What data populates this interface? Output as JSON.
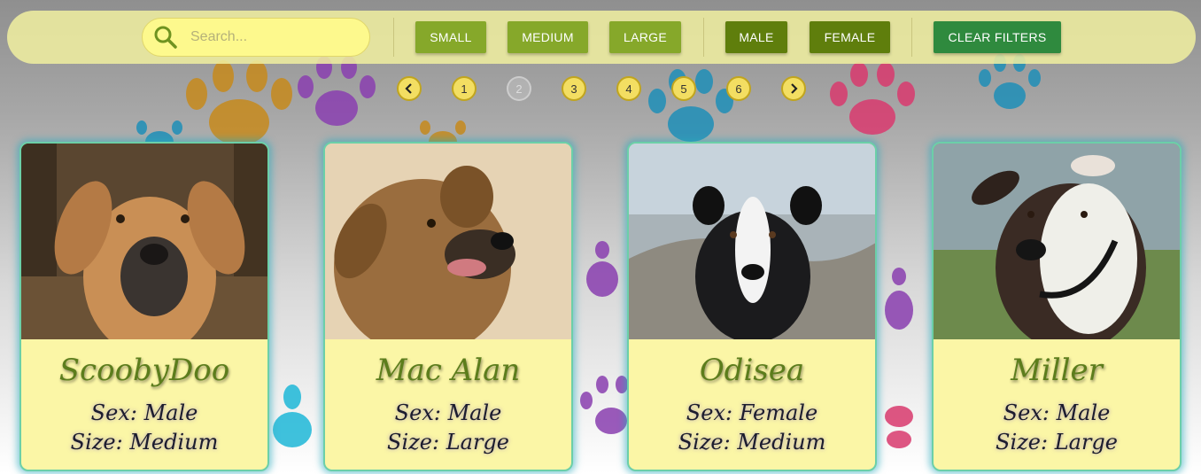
{
  "search": {
    "placeholder": "Search...",
    "value": ""
  },
  "filters": {
    "size": [
      "SMALL",
      "MEDIUM",
      "LARGE"
    ],
    "sex": [
      "MALE",
      "FEMALE"
    ],
    "clear": "CLEAR FILTERS"
  },
  "pagination": {
    "pages": [
      "1",
      "2",
      "3",
      "4",
      "5",
      "6"
    ],
    "current_page": "2"
  },
  "cards": [
    {
      "name": "ScoobyDoo",
      "sex_label": "Sex: Male",
      "size_label": "Size: Medium"
    },
    {
      "name": "Mac Alan",
      "sex_label": "Sex: Male",
      "size_label": "Size: Large"
    },
    {
      "name": "Odisea",
      "sex_label": "Sex: Female",
      "size_label": "Size: Medium"
    },
    {
      "name": "Miller",
      "sex_label": "Sex: Male",
      "size_label": "Size: Large"
    }
  ],
  "colors": {
    "toolbar_bg": "#f1f0a0",
    "size_button": "#86a82a",
    "sex_button": "#5f7e0c",
    "clear_button": "#2f8a3e",
    "card_bg": "#fbf6a6",
    "dog_name": "#5c7d1c",
    "page_dot": "#f3de62"
  },
  "icons": [
    "search-icon",
    "chevron-left-icon",
    "chevron-right-icon",
    "paw-print-icon"
  ]
}
